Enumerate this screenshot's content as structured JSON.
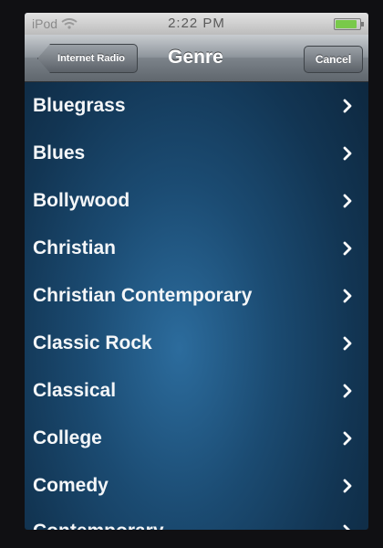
{
  "status_bar": {
    "carrier": "iPod",
    "time": "2:22 PM",
    "battery_level": 0.9
  },
  "nav_bar": {
    "back_label": "Internet Radio",
    "title": "Genre",
    "cancel_label": "Cancel"
  },
  "genres": [
    {
      "label": "Bluegrass"
    },
    {
      "label": "Blues"
    },
    {
      "label": "Bollywood"
    },
    {
      "label": "Christian"
    },
    {
      "label": "Christian Contemporary"
    },
    {
      "label": "Classic Rock"
    },
    {
      "label": "Classical"
    },
    {
      "label": "College"
    },
    {
      "label": "Comedy"
    },
    {
      "label": "Contemporary"
    }
  ],
  "colors": {
    "accent": "#1b4b72",
    "text": "#f4f6f8"
  }
}
